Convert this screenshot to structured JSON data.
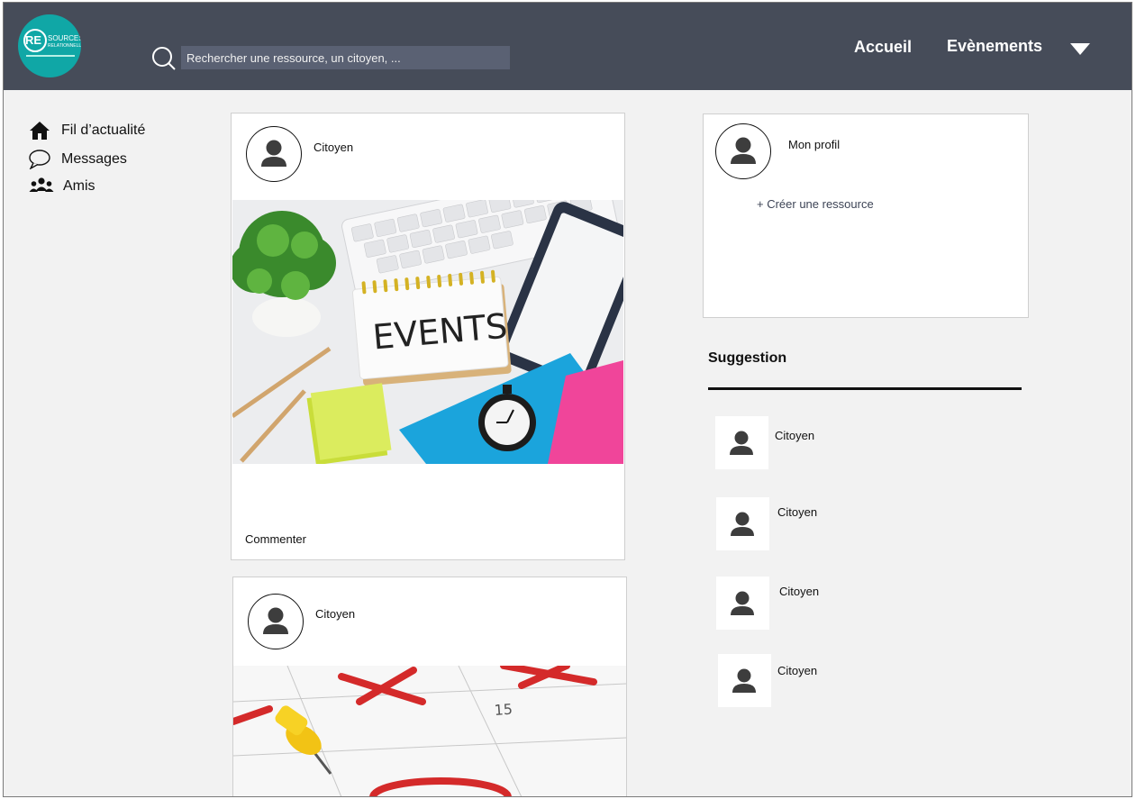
{
  "header": {
    "logo_text": "RE",
    "logo_sub": [
      "SOURCES",
      "RELATIONNELLES"
    ],
    "search": {
      "placeholder": "Rechercher une ressource, un citoyen, ..."
    },
    "nav": {
      "home": "Accueil",
      "events": "Evènements"
    },
    "colors": {
      "bar": "#464c59",
      "logo": "#10a7a6"
    }
  },
  "sidebar": {
    "items": [
      {
        "label": "Fil d’actualité",
        "icon": "home-icon"
      },
      {
        "label": "Messages",
        "icon": "chat-bubble-icon"
      },
      {
        "label": "Amis",
        "icon": "friends-icon"
      }
    ]
  },
  "feed": {
    "posts": [
      {
        "author": "Citoyen",
        "image_text": "EVENTS",
        "action": "Commenter"
      },
      {
        "author": "Citoyen",
        "image_text": "15"
      }
    ]
  },
  "profile": {
    "title": "Mon profil",
    "create_link": "+ Créer une ressource"
  },
  "suggestions": {
    "title": "Suggestion",
    "items": [
      {
        "name": "Citoyen"
      },
      {
        "name": "Citoyen"
      },
      {
        "name": "Citoyen"
      },
      {
        "name": "Citoyen"
      }
    ]
  }
}
